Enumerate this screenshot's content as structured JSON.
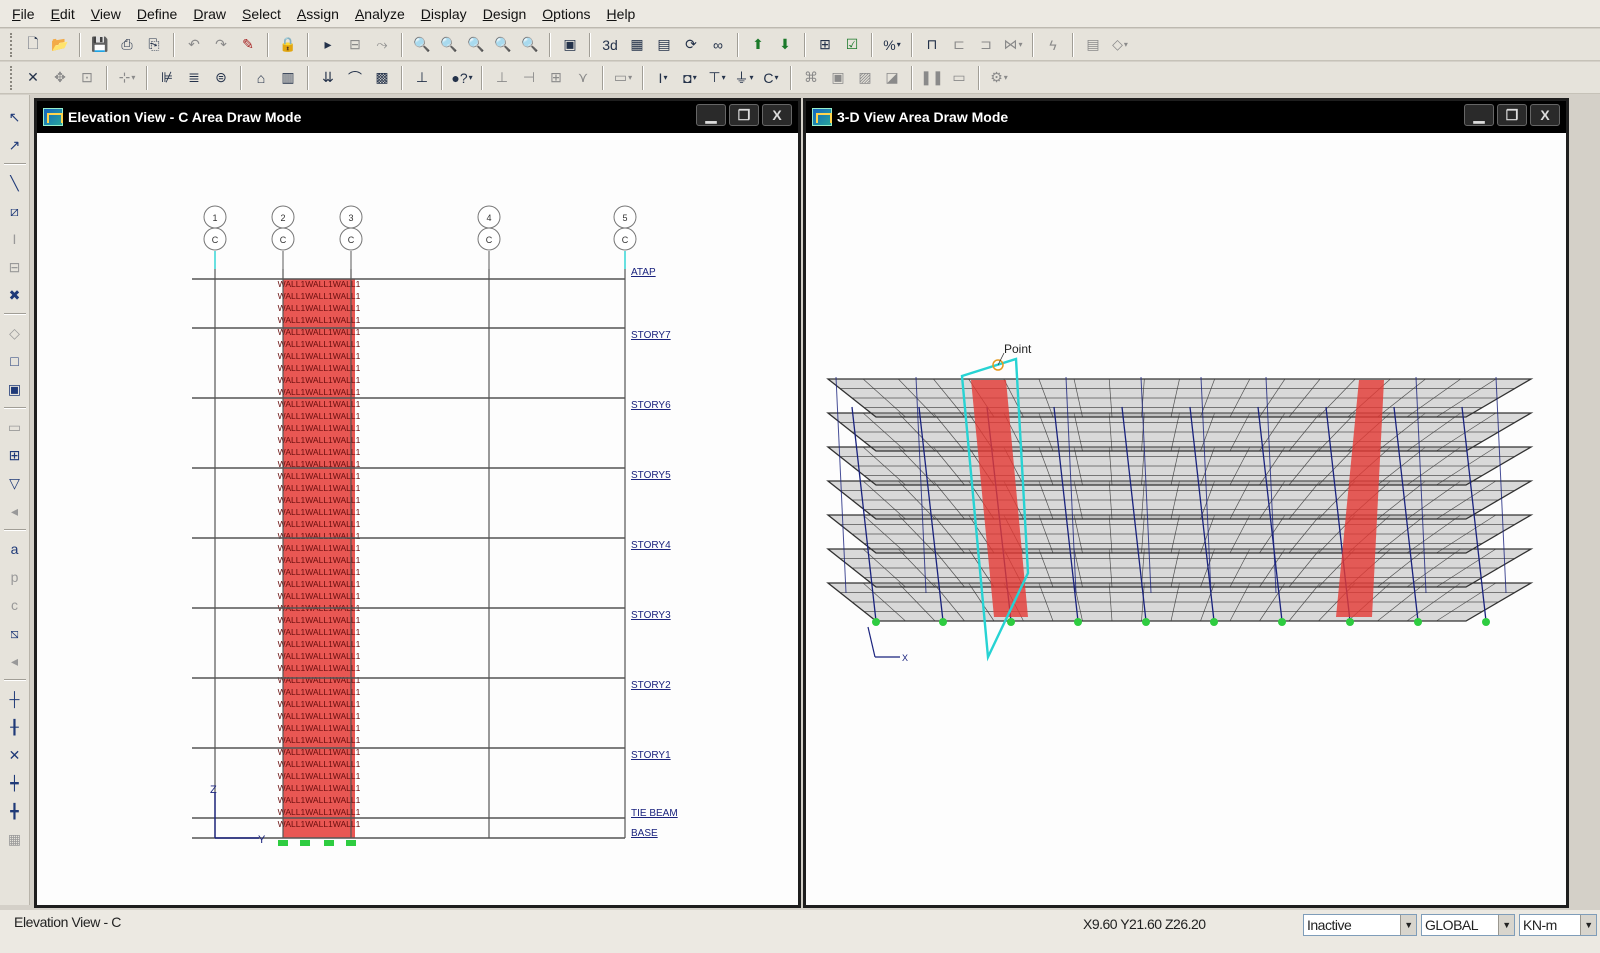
{
  "menu": [
    "File",
    "Edit",
    "View",
    "Define",
    "Draw",
    "Select",
    "Assign",
    "Analyze",
    "Display",
    "Design",
    "Options",
    "Help"
  ],
  "elevation_window": {
    "title": "Elevation View - C  Area Draw Mode",
    "grid_bubbles": [
      {
        "top": "1",
        "bottom": "C"
      },
      {
        "top": "2",
        "bottom": "C"
      },
      {
        "top": "3",
        "bottom": "C"
      },
      {
        "top": "4",
        "bottom": "C"
      },
      {
        "top": "5",
        "bottom": "C"
      }
    ],
    "stories": [
      "ATAP",
      "STORY7",
      "STORY6",
      "STORY5",
      "STORY4",
      "STORY3",
      "STORY2",
      "STORY1",
      "TIE BEAM",
      "BASE"
    ],
    "wall_label": "WALL1WALL1WALL1",
    "axis_z": "Z",
    "axis_y": "Y"
  },
  "view3d_window": {
    "title": "3-D View  Area Draw Mode",
    "point_label": "Point",
    "axis_x": "X"
  },
  "window_buttons": {
    "minimize": "▁",
    "restore": "❐",
    "close": "X"
  },
  "status": {
    "view_name": "Elevation View - C",
    "coordinates": "X9.60  Y21.60  Z26.20",
    "state": "Inactive",
    "coord_system": "GLOBAL",
    "units": "KN-m"
  },
  "colors": {
    "wall": "#e53935",
    "frame": "#1a237e",
    "support": "#2ecc40",
    "highlight": "#27d3d3"
  }
}
